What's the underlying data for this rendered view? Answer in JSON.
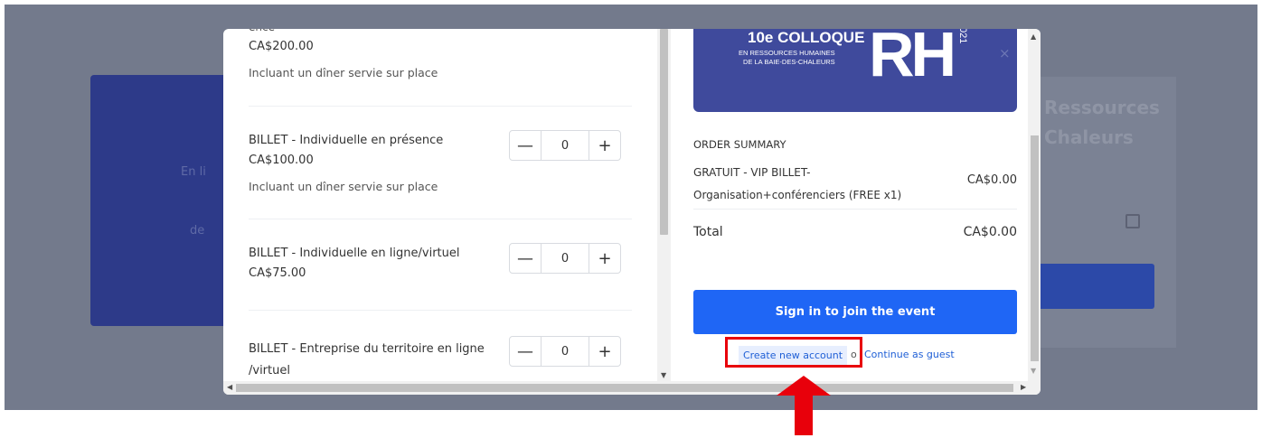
{
  "background": {
    "blurred_heading": "Ressources",
    "blurred_subheading": "Chaleurs",
    "left_card_line1": "En li",
    "left_card_line2": "de"
  },
  "tickets": [
    {
      "name": "ence",
      "price": "CA$200.00",
      "note": "Incluant un dîner servie sur place"
    },
    {
      "name": "BILLET - Individuelle en présence",
      "price": "CA$100.00",
      "note": "Incluant un dîner servie sur place",
      "quantity": "0"
    },
    {
      "name": "BILLET - Individuelle en ligne/virtuel",
      "price": "CA$75.00",
      "quantity": "0"
    },
    {
      "name": "BILLET - Entreprise du territoire en ligne /virtuel",
      "quantity": "0"
    }
  ],
  "qty_controls": {
    "minus": "—",
    "plus": "+"
  },
  "banner": {
    "edition": "10e COLLOQUE",
    "line2": "EN RESSOURCES HUMAINES",
    "line3": "DE LA BAIE-DES-CHALEURS",
    "logo": "RH",
    "year": "021",
    "close": "×"
  },
  "order_summary": {
    "title": "ORDER SUMMARY",
    "item_label": "GRATUIT - VIP BILLET- Organisation+conférenciers (FREE x1)",
    "item_price": "CA$0.00",
    "total_label": "Total",
    "total_value": "CA$0.00"
  },
  "actions": {
    "sign_in": "Sign in to join the event",
    "create_account": "Create new account",
    "or": "o",
    "continue_guest": "Continue as guest"
  },
  "annotation": {
    "highlight_color": "#e8000b"
  }
}
